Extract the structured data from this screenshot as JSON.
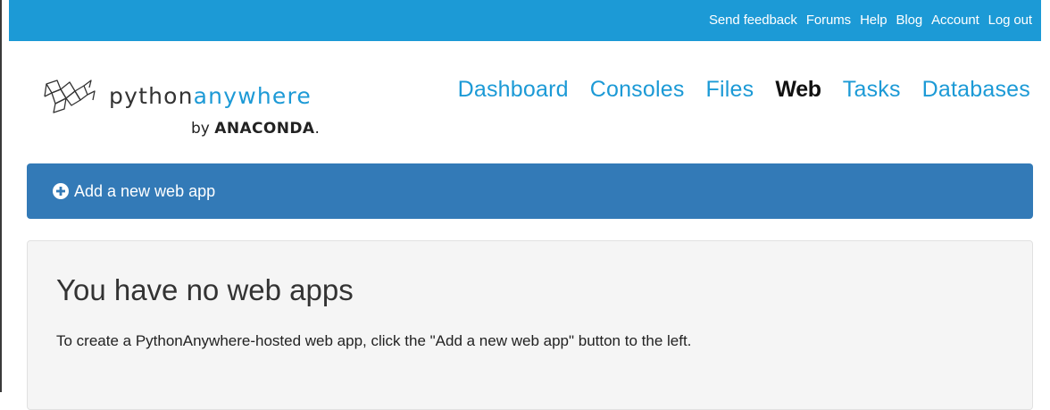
{
  "topbar": {
    "links": [
      "Send feedback",
      "Forums",
      "Help",
      "Blog",
      "Account",
      "Log out"
    ]
  },
  "logo": {
    "name_part1": "python",
    "name_part2": "anywhere",
    "by": "by",
    "brand": "ANACONDA",
    "brand_suffix": "."
  },
  "nav": {
    "items": [
      {
        "label": "Dashboard",
        "active": false
      },
      {
        "label": "Consoles",
        "active": false
      },
      {
        "label": "Files",
        "active": false
      },
      {
        "label": "Web",
        "active": true
      },
      {
        "label": "Tasks",
        "active": false
      },
      {
        "label": "Databases",
        "active": false
      }
    ]
  },
  "add_web_app": {
    "label": "Add a new web app",
    "icon": "plus-circle-icon"
  },
  "empty_state": {
    "title": "You have no web apps",
    "message": "To create a PythonAnywhere-hosted web app, click the \"Add a new web app\" button to the left."
  },
  "colors": {
    "topbar": "#1c9ad6",
    "nav_link": "#1c9ad6",
    "add_bar": "#337ab7",
    "panel_bg": "#f5f5f5"
  }
}
